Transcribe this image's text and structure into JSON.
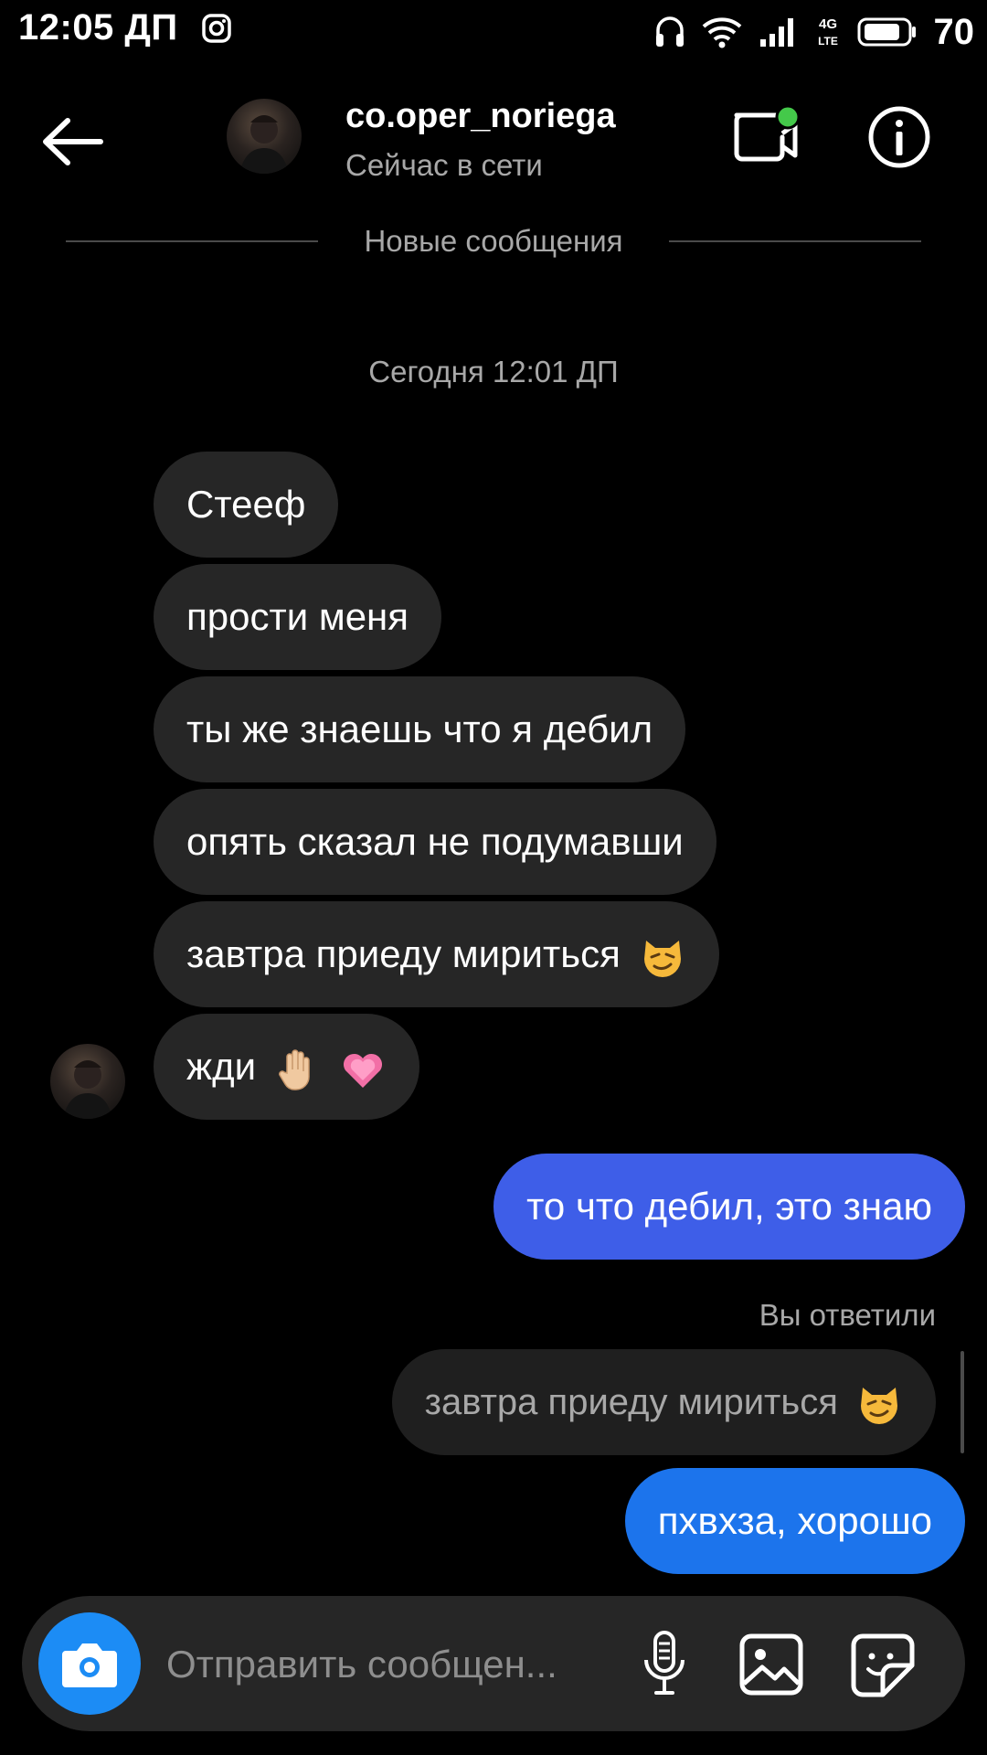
{
  "status_bar": {
    "time": "12:05 ДП",
    "network": "4G LTE",
    "battery": "70"
  },
  "header": {
    "username": "co.oper_noriega",
    "status": "Сейчас в сети"
  },
  "divider": {
    "label": "Новые сообщения"
  },
  "date_label": "Сегодня 12:01 ДП",
  "incoming": [
    {
      "text": "Стееф"
    },
    {
      "text": "прости меня"
    },
    {
      "text": "ты же знаешь что я дебил"
    },
    {
      "text": "опять сказал не подумавши"
    },
    {
      "text": "завтра приеду мириться",
      "emoji": [
        "smirking-cat-face"
      ]
    },
    {
      "text": "жди",
      "emoji": [
        "raised-hand",
        "growing-heart"
      ]
    }
  ],
  "outgoing": [
    {
      "text": "то что дебил, это знаю"
    },
    {
      "text": "пхвхза, хорошо"
    }
  ],
  "reply": {
    "label": "Вы ответили",
    "quoted_text": "завтра приеду мириться",
    "quoted_emoji": "smirking-cat-face"
  },
  "composer": {
    "placeholder": "Отправить сообщен..."
  },
  "colors": {
    "incoming_bubble": "#262626",
    "outgoing_bubble_1": "#3e5ee8",
    "outgoing_bubble_2": "#1c74ec",
    "camera_button": "#1c8cf5",
    "online_dot": "#44c94a"
  }
}
